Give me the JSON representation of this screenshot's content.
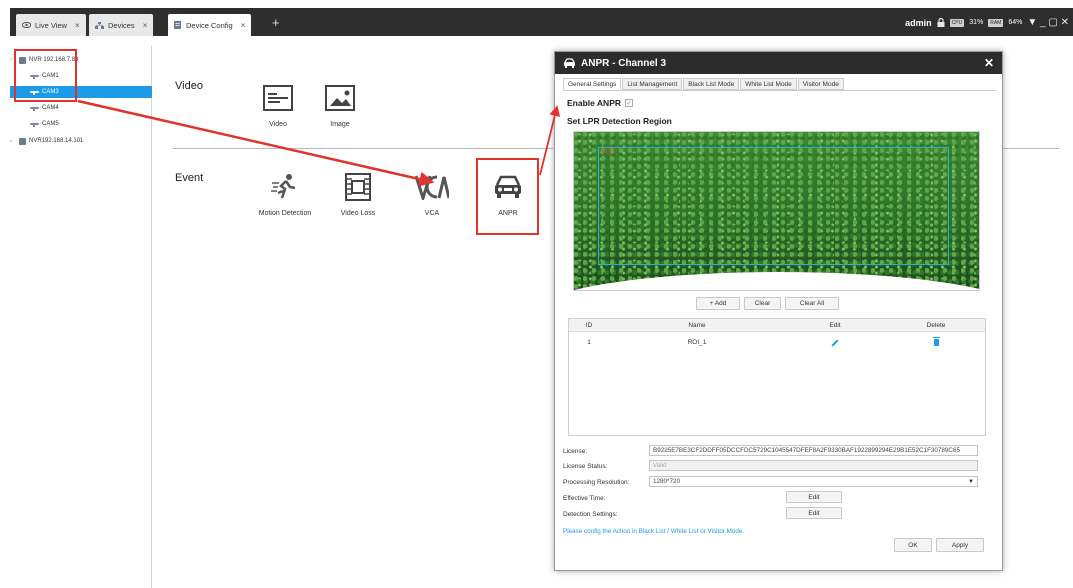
{
  "tabs": [
    {
      "label": "Live View",
      "close": "×"
    },
    {
      "label": "Devices",
      "close": "×"
    },
    {
      "label": "Device Config",
      "close": "×"
    }
  ],
  "add_tab": "+",
  "topbar": {
    "user": "admin",
    "cpu_label": "CPU",
    "cpu_value": "31%",
    "ram_label": "RAM",
    "ram_value": "64%",
    "window_controls": "▼ _ ▢ ✕"
  },
  "tree": [
    {
      "label": "NVR 192.168.7.83",
      "type": "nvr"
    },
    {
      "label": "CAM1",
      "type": "cam"
    },
    {
      "label": "CAM3",
      "type": "cam",
      "selected": true
    },
    {
      "label": "CAM4",
      "type": "cam"
    },
    {
      "label": "CAM5",
      "type": "cam"
    },
    {
      "label": "NVR192.168.14.101",
      "type": "nvr"
    }
  ],
  "main": {
    "video_title": "Video",
    "event_title": "Event",
    "video_items": [
      {
        "label": "Video",
        "icon": "video-settings-icon"
      },
      {
        "label": "Image",
        "icon": "image-settings-icon"
      }
    ],
    "event_items": [
      {
        "label": "Motion Detection",
        "icon": "motion-detection-icon"
      },
      {
        "label": "Video Loss",
        "icon": "video-loss-icon"
      },
      {
        "label": "VCA",
        "icon": "vca-icon"
      },
      {
        "label": "ANPR",
        "icon": "anpr-car-icon"
      }
    ]
  },
  "dialog": {
    "title": "ANPR - Channel 3",
    "close": "✕",
    "tabs": [
      "General Settings",
      "List Management",
      "Black List Mode",
      "White List Mode",
      "Visitor Mode"
    ],
    "enable_label": "Enable ANPR",
    "enable_check": "✓",
    "region_label": "Set LPR Detection Region",
    "roi_overlay_label": "ROI_1",
    "add_label": "+ Add",
    "clear_label": "Clear",
    "clear_all_label": "Clear All",
    "table": {
      "headers": [
        "ID",
        "Name",
        "Edit",
        "Delete"
      ],
      "rows": [
        {
          "id": "1",
          "name": "ROI_1"
        }
      ]
    },
    "license_label": "License:",
    "license_value": "B9225E7BE3CF2DDFF05DCCFDC5729C1045547DFEF8A2F9330BAF1922899294E29B1E52C1F30789C65",
    "license_status_label": "License Status:",
    "license_status_value": "Valid",
    "processing_label": "Processing Resolution:",
    "processing_value": "1280*720",
    "effective_label": "Effective Time:",
    "detection_label": "Detection Settings:",
    "edit_label": "Edit",
    "note": "Please config the Action in Black List / White List or Visitor Mode.",
    "ok_label": "OK",
    "apply_label": "Apply"
  },
  "colors": {
    "accent": "#1b9be8",
    "highlight": "#e0332b",
    "titlebar": "#2c2c2c"
  }
}
